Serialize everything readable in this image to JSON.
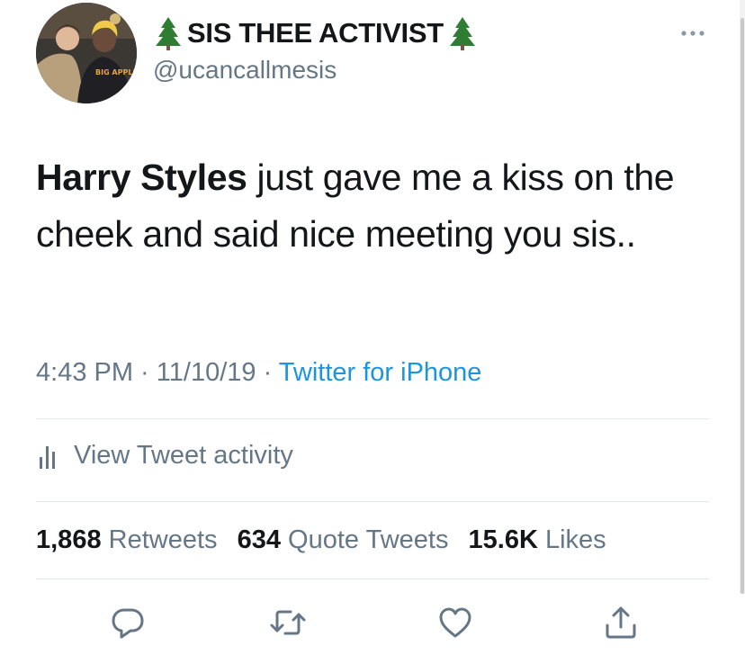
{
  "author": {
    "display_name": "SIS THEE ACTIVIST",
    "name_emoji": "evergreen-tree-icon",
    "handle": "@ucancallmesis",
    "avatar_shirt_text": "BIG APPLE CIRCUS"
  },
  "tweet": {
    "mention": "Harry Styles",
    "text": " just gave me a kiss on the cheek and said nice meeting you sis.."
  },
  "meta": {
    "time": "4:43 PM",
    "separator": " · ",
    "date": "11/10/19",
    "source": "Twitter for iPhone"
  },
  "activity": {
    "label": "View Tweet activity",
    "icon": "bar-chart-icon"
  },
  "stats": {
    "retweets_count": "1,868",
    "retweets_label": "Retweets",
    "quotes_count": "634",
    "quotes_label": "Quote Tweets",
    "likes_count": "15.6K",
    "likes_label": "Likes"
  },
  "actions": [
    {
      "name": "reply",
      "icon": "reply-icon"
    },
    {
      "name": "retweet",
      "icon": "retweet-icon"
    },
    {
      "name": "like",
      "icon": "heart-icon"
    },
    {
      "name": "share",
      "icon": "share-icon"
    }
  ],
  "colors": {
    "text_primary": "#14171a",
    "text_secondary": "#657786",
    "link": "#1b95e0",
    "divider": "#e1e8ed",
    "tree_green": "#2e7d32"
  }
}
